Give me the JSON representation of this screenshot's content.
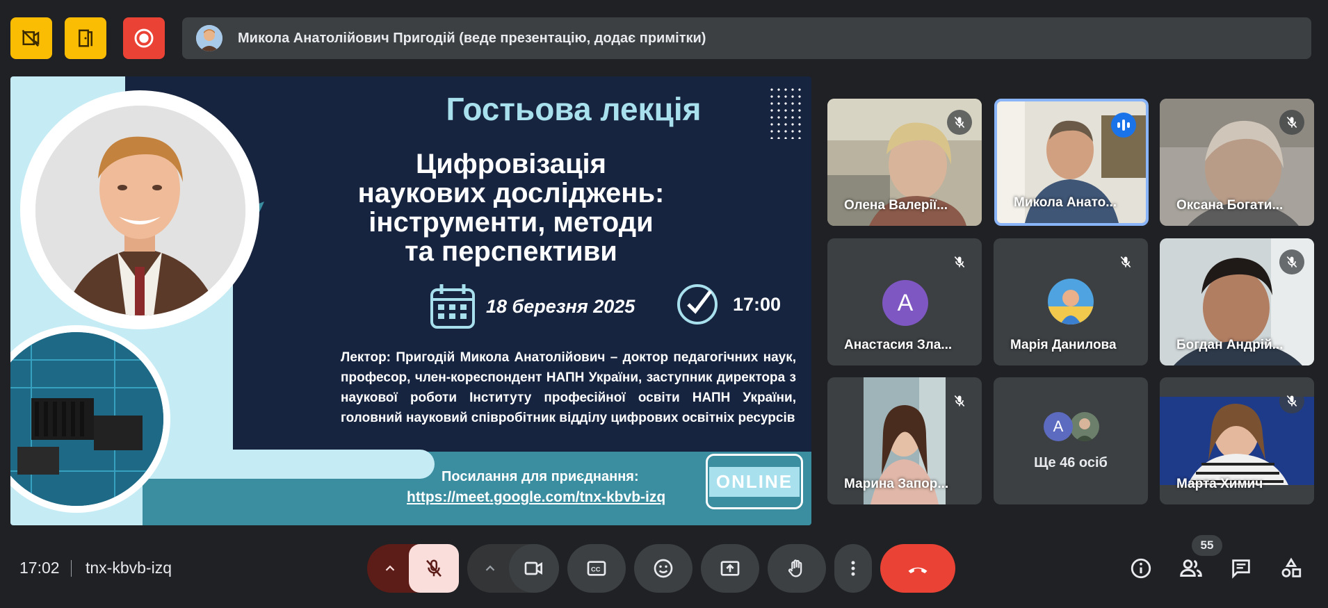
{
  "top_bar": {
    "presenter_text": "Микола Анатолійович Пригодій (веде презентацію, додає примітки)"
  },
  "slide": {
    "title": "Гостьова лекція",
    "subtitle_lines": [
      "Цифровізація",
      "наукових досліджень:",
      "інструменти, методи",
      "та перспективи"
    ],
    "date": "18 березня 2025",
    "time": "17:00",
    "lecturer": "Лектор: Пригодій Микола Анатолійович – доктор педагогічних наук, професор, член-кореспондент НАПН України, заступник директора з наукової роботи Інституту професійної освіти НАПН України, головний науковий співробітник відділу цифрових освітніх ресурсів",
    "join_label": "Посилання для приєднання:",
    "join_link": "https://meet.google.com/tnx-kbvb-izq",
    "online_label": "ONLINE"
  },
  "participants": [
    {
      "name": "Олена Валерії...",
      "state": "muted"
    },
    {
      "name": "Микола Анато...",
      "state": "speaking"
    },
    {
      "name": "Оксана Богати...",
      "state": "muted"
    },
    {
      "name": "Анастасия Зла...",
      "state": "muted",
      "initial": "А"
    },
    {
      "name": "Марія Данилова",
      "state": "muted"
    },
    {
      "name": "Богдан Андрій...",
      "state": "muted"
    },
    {
      "name": "Марина Запор...",
      "state": "muted"
    },
    {
      "name": "Ще 46 осіб",
      "initial": "A"
    },
    {
      "name": "Марта Химич",
      "state": "muted"
    }
  ],
  "bottom_bar": {
    "time": "17:02",
    "meeting_code": "tnx-kbvb-izq",
    "participant_count": "55"
  },
  "icons": {
    "top": [
      "no-video-icon",
      "door-icon",
      "record-icon"
    ],
    "controls": [
      "chevron-up-icon",
      "mic-off-icon",
      "camera-icon",
      "captions-icon",
      "emoji-icon",
      "present-icon",
      "raise-hand-icon",
      "more-icon",
      "end-call-icon"
    ],
    "right": [
      "info-icon",
      "people-icon",
      "chat-icon",
      "activities-icon"
    ]
  },
  "colors": {
    "background": "#202124",
    "surface": "#3c4043",
    "accent_blue": "#8ab4f8",
    "danger": "#ea4335",
    "warning": "#fbbc04"
  }
}
